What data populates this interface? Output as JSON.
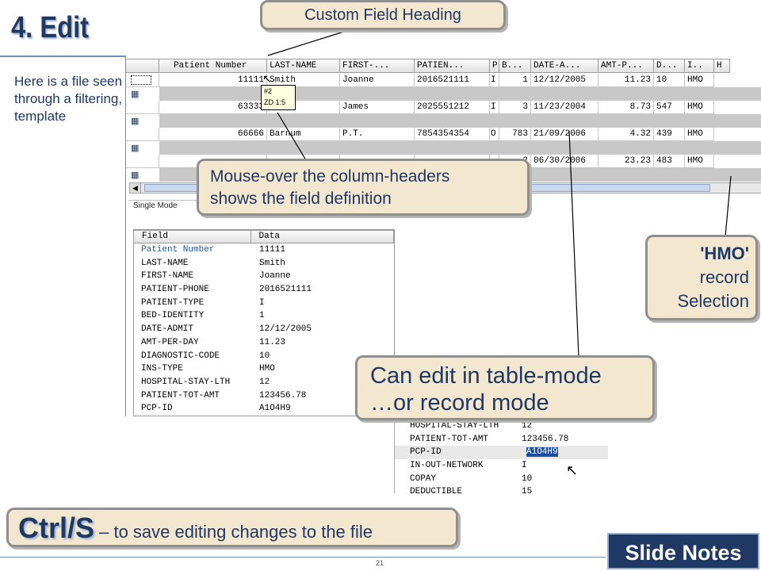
{
  "slide": {
    "title": "4. Edit",
    "intro": "Here is a file seen through a filtering, template",
    "page_number": "21",
    "notes_label": "Slide Notes"
  },
  "grid": {
    "headers": [
      "Patient Number",
      "LAST-NAME",
      "FIRST-...",
      "PATIEN...",
      "P",
      "B...",
      "DATE-A...",
      "AMT-P...",
      "D...",
      "I..",
      "H"
    ],
    "rows": [
      {
        "cells": [
          "11111",
          "Smith",
          "Joanne",
          "2016521111",
          "I",
          "1",
          "12/12/2005",
          "11.23",
          "10",
          "HMO"
        ]
      },
      {
        "cells": [
          "63333",
          "Jones",
          "James",
          "2025551212",
          "I",
          "3",
          "11/23/2004",
          "8.73",
          "547",
          "HMO"
        ]
      },
      {
        "cells": [
          "66666",
          "Barnum",
          "P.T.",
          "7854354354",
          "O",
          "783",
          "21/09/2006",
          "4.32",
          "439",
          "HMO"
        ]
      },
      {
        "cells": [
          "",
          "",
          "",
          "",
          "",
          "2",
          "06/30/2006",
          "23.23",
          "483",
          "HMO"
        ]
      }
    ],
    "tooltip_line1": "#2",
    "tooltip_line2": "ZD 1:5"
  },
  "single_mode": {
    "tab_label": "Single Mode",
    "col_field": "Field",
    "col_data": "Data",
    "fields": [
      {
        "name": "Patient Number",
        "value": "11111"
      },
      {
        "name": "LAST-NAME",
        "value": "Smith"
      },
      {
        "name": "FIRST-NAME",
        "value": "Joanne"
      },
      {
        "name": "PATIENT-PHONE",
        "value": "2016521111"
      },
      {
        "name": "PATIENT-TYPE",
        "value": "I"
      },
      {
        "name": "BED-IDENTITY",
        "value": "1"
      },
      {
        "name": "DATE-ADMIT",
        "value": "12/12/2005"
      },
      {
        "name": "AMT-PER-DAY",
        "value": "11.23"
      },
      {
        "name": "DIAGNOSTIC-CODE",
        "value": "10"
      },
      {
        "name": "INS-TYPE",
        "value": "HMO"
      },
      {
        "name": "HOSPITAL-STAY-LTH",
        "value": "12"
      },
      {
        "name": "PATIENT-TOT-AMT",
        "value": "123456.78"
      },
      {
        "name": "PCP-ID",
        "value": "A1O4H9"
      }
    ]
  },
  "second_pane": {
    "fields": [
      {
        "name": "HOSPITAL-STAY-LTH",
        "value": "12"
      },
      {
        "name": "PATIENT-TOT-AMT",
        "value": "123456.78"
      },
      {
        "name": "PCP-ID",
        "value": "A1O4H9"
      },
      {
        "name": "IN-OUT-NETWORK",
        "value": "I"
      },
      {
        "name": "COPAY",
        "value": "10"
      },
      {
        "name": "DEDUCTIBLE",
        "value": "15"
      }
    ]
  },
  "callouts": {
    "custom_heading": "Custom Field Heading",
    "mouseover_line1": "Mouse-over the column-headers",
    "mouseover_line2": "shows the field definition",
    "hmo_line1": "'HMO'",
    "hmo_line2": "record",
    "hmo_line3": "Selection",
    "edit_line1": "Can edit in table-mode",
    "edit_line2": "…or record mode",
    "ctrl_key": "Ctrl/S",
    "ctrl_text": " – to save editing changes to the file"
  },
  "colors": {
    "title": "#1f3864",
    "callout_bg": "#f3e7d0",
    "notes_bg": "#1f3864"
  }
}
